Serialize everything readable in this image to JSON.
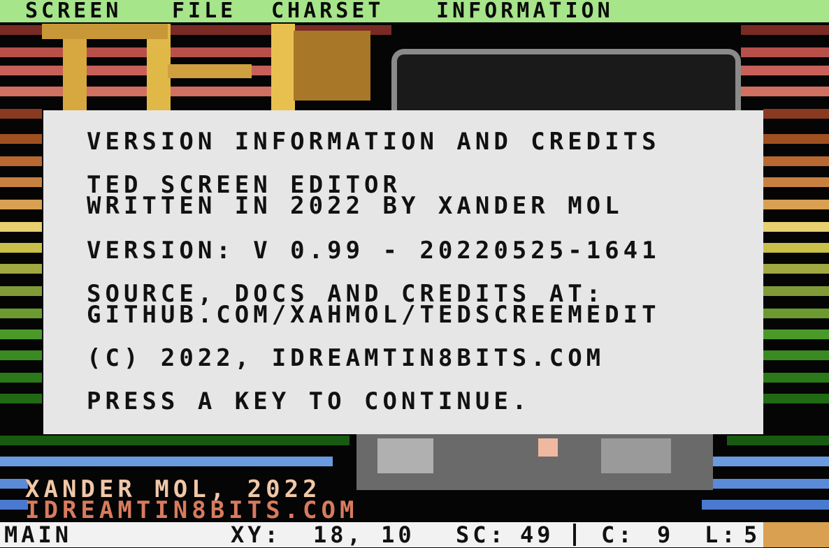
{
  "menu": {
    "items": [
      {
        "label": "SCREEN"
      },
      {
        "label": "FILE"
      },
      {
        "label": "CHARSET"
      },
      {
        "label": "INFORMATION"
      }
    ]
  },
  "dialog": {
    "title": "VERSION INFORMATION AND CREDITS",
    "app_name": "TED SCREEN EDITOR",
    "author_line": "WRITTEN IN 2022 BY XANDER MOL",
    "version_line": "VERSION: V 0.99 - 20220525-1641",
    "source_line": "SOURCE, DOCS AND CREDITS AT:",
    "url_line": "GITHUB.COM/XAHMOL/TEDSCREEMEDIT",
    "copyright_line": "(C) 2022, IDREAMTIN8BITS.COM",
    "prompt": "PRESS A KEY TO CONTINUE."
  },
  "art_credits": {
    "line1": "XANDER MOL, 2022",
    "line2": "IDREAMTIN8BITS.COM"
  },
  "status": {
    "mode": "MAIN",
    "xy_label": "XY:",
    "xy_value": "18, 10",
    "sc_label": "SC:",
    "sc_value": "49",
    "c_label": "C:",
    "c_value": "9",
    "l_label": "L:",
    "l_value": "5"
  },
  "colors": {
    "menu_bg": "#a6e58a",
    "dialog_bg": "#e6e6e6",
    "status_bg": "#f2f2f2",
    "credit_line1": "#f0c8a8",
    "credit_line2": "#d97b5e"
  }
}
